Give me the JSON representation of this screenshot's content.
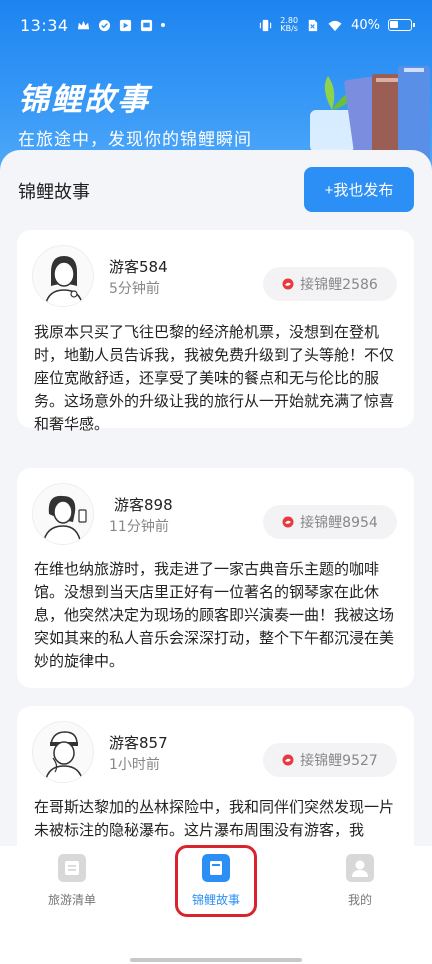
{
  "status_bar": {
    "time": "13:34",
    "network_speed_value": "2.80",
    "network_speed_unit": "KB/s",
    "battery": "40%"
  },
  "header": {
    "title": "锦鲤故事",
    "subtitle": "在旅途中，发现你的锦鲤瞬间"
  },
  "section": {
    "title": "锦鲤故事",
    "publish_label": "+我也发布"
  },
  "stories": [
    {
      "user": "游客584",
      "time": "5分钟前",
      "connect_label": "接锦鲤2586",
      "text": "我原本只买了飞往巴黎的经济舱机票，没想到在登机时，地勤人员告诉我，我被免费升级到了头等舱！不仅座位宽敞舒适，还享受了美味的餐点和无与伦比的服务。这场意外的升级让我的旅行从一开始就充满了惊喜和奢华感。"
    },
    {
      "user": "游客898",
      "time": "11分钟前",
      "connect_label": "接锦鲤8954",
      "text": "在维也纳旅游时，我走进了一家古典音乐主题的咖啡馆。没想到当天店里正好有一位著名的钢琴家在此休息，他突然决定为现场的顾客即兴演奏一曲！我被这场突如其来的私人音乐会深深打动，整个下午都沉浸在美妙的旋律中。"
    },
    {
      "user": "游客857",
      "time": "1小时前",
      "connect_label": "接锦鲤9527",
      "text": "在哥斯达黎加的丛林探险中，我和同伴们突然发现一片未被标注的隐秘瀑布。这片瀑布周围没有游客，我"
    }
  ],
  "tabbar": {
    "items": [
      {
        "label": "旅游清单",
        "icon": "list-icon",
        "active": false
      },
      {
        "label": "锦鲤故事",
        "icon": "book-icon",
        "active": true
      },
      {
        "label": "我的",
        "icon": "person-icon",
        "active": false
      }
    ]
  },
  "colors": {
    "primary": "#2c8ff6",
    "highlight_border": "#d9232d",
    "koi_icon": "#e8393f"
  }
}
